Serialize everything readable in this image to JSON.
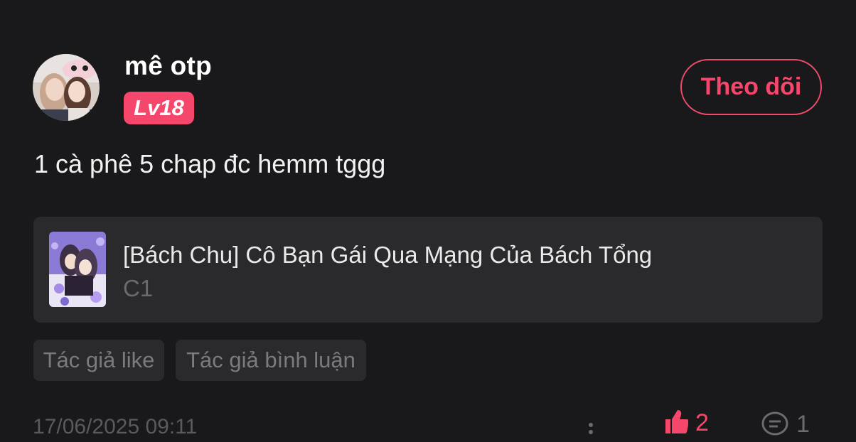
{
  "post": {
    "username": "mê otp",
    "level": "Lv18",
    "follow_label": "Theo dõi",
    "comment": "1 cà phê 5 chap đc hemm tggg",
    "timestamp": "17/06/2025 09:11",
    "like_count": "2",
    "comment_count": "1"
  },
  "manga": {
    "title": "[Bách Chu] Cô Bạn Gái Qua Mạng Của Bách Tổng",
    "chapter": "C1"
  },
  "tags": {
    "author_like": "Tác giả like",
    "author_comment": "Tác giả bình luận"
  },
  "colors": {
    "background": "#19191b",
    "accent": "#f5476b",
    "card": "#2a2a2c",
    "muted_text": "#6a6a6d"
  },
  "icons": {
    "more": "more-dots-icon",
    "like": "thumbs-up-icon",
    "comment": "comment-bubble-icon"
  }
}
